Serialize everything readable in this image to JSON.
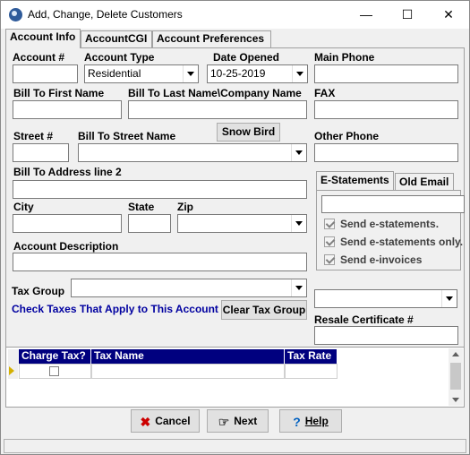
{
  "window": {
    "title": "Add, Change, Delete Customers",
    "min": "—",
    "max": "☐",
    "close": "✕"
  },
  "tabs": [
    "Account Info",
    "AccountCGI",
    "Account Preferences"
  ],
  "form": {
    "account_no": {
      "label": "Account #",
      "value": ""
    },
    "account_type": {
      "label": "Account Type",
      "value": "Residential"
    },
    "date_opened": {
      "label": "Date Opened",
      "value": "10-25-2019"
    },
    "main_phone": {
      "label": "Main Phone",
      "value": ""
    },
    "first_name": {
      "label": "Bill To First Name",
      "value": ""
    },
    "last_name": {
      "label": "Bill To Last Name\\Company Name",
      "value": ""
    },
    "fax": {
      "label": "FAX",
      "value": ""
    },
    "street_no": {
      "label": "Street #",
      "value": ""
    },
    "street_name": {
      "label": "Bill To Street Name",
      "value": ""
    },
    "snow_bird": "Snow Bird",
    "other_phone": {
      "label": "Other Phone",
      "value": ""
    },
    "address2": {
      "label": "Bill To Address line 2",
      "value": ""
    },
    "city": {
      "label": "City",
      "value": ""
    },
    "state": {
      "label": "State",
      "value": ""
    },
    "zip": {
      "label": "Zip",
      "value": ""
    },
    "description": {
      "label": "Account Description",
      "value": ""
    },
    "tax_group": {
      "label": "Tax Group",
      "value": ""
    },
    "check_taxes": "Check Taxes That Apply to This Account",
    "clear_tax_group": "Clear Tax Group",
    "resale_combo": "",
    "resale_cert": {
      "label": "Resale Certificate #",
      "value": ""
    }
  },
  "estatements": {
    "tabs": [
      "E-Statements",
      "Old Email"
    ],
    "email": "",
    "options": [
      "Send e-statements.",
      "Send e-statements only.",
      "Send e-invoices"
    ]
  },
  "grid": {
    "columns": [
      "Charge Tax?",
      "Tax Name",
      "Tax Rate"
    ]
  },
  "buttons": {
    "cancel": "Cancel",
    "next": "Next",
    "help": "Help"
  },
  "colors": {
    "grid_header": "#00007f",
    "link_text": "#0000a0",
    "cancel_icon": "#cc0000",
    "help_icon": "#0060c0"
  }
}
